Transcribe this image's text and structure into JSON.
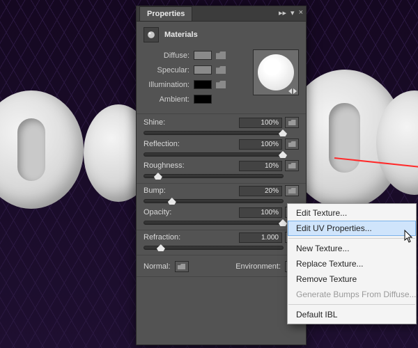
{
  "panel": {
    "title": "Properties",
    "section": "Materials",
    "icon": "sphere-material-icon",
    "collapse_glyph": "▸▸",
    "menu_glyph": "▾",
    "close_glyph": "×"
  },
  "material_channels": {
    "diffuse": {
      "label": "Diffuse:",
      "color": "#8a8a8a"
    },
    "specular": {
      "label": "Specular:",
      "color": "#8a8a8a"
    },
    "illumination": {
      "label": "Illumination:",
      "color": "#000000"
    },
    "ambient": {
      "label": "Ambient:",
      "color": "#000000"
    }
  },
  "preview_label": "material-preview",
  "sliders": {
    "shine": {
      "label": "Shine:",
      "value": "100%",
      "pos": 100
    },
    "reflection": {
      "label": "Reflection:",
      "value": "100%",
      "pos": 100
    },
    "roughness": {
      "label": "Roughness:",
      "value": "10%",
      "pos": 10
    },
    "bump": {
      "label": "Bump:",
      "value": "20%",
      "pos": 20
    },
    "opacity": {
      "label": "Opacity:",
      "value": "100%",
      "pos": 100
    },
    "refraction": {
      "label": "Refraction:",
      "value": "1.000",
      "pos": 12
    }
  },
  "bottom": {
    "normal": "Normal:",
    "environment": "Environment:"
  },
  "context_menu": {
    "edit_texture": "Edit Texture...",
    "edit_uv": "Edit UV Properties...",
    "new_texture": "New Texture...",
    "replace_texture": "Replace Texture...",
    "remove_texture": "Remove Texture",
    "gen_bumps": "Generate Bumps From Diffuse...",
    "default_ibl": "Default IBL"
  }
}
